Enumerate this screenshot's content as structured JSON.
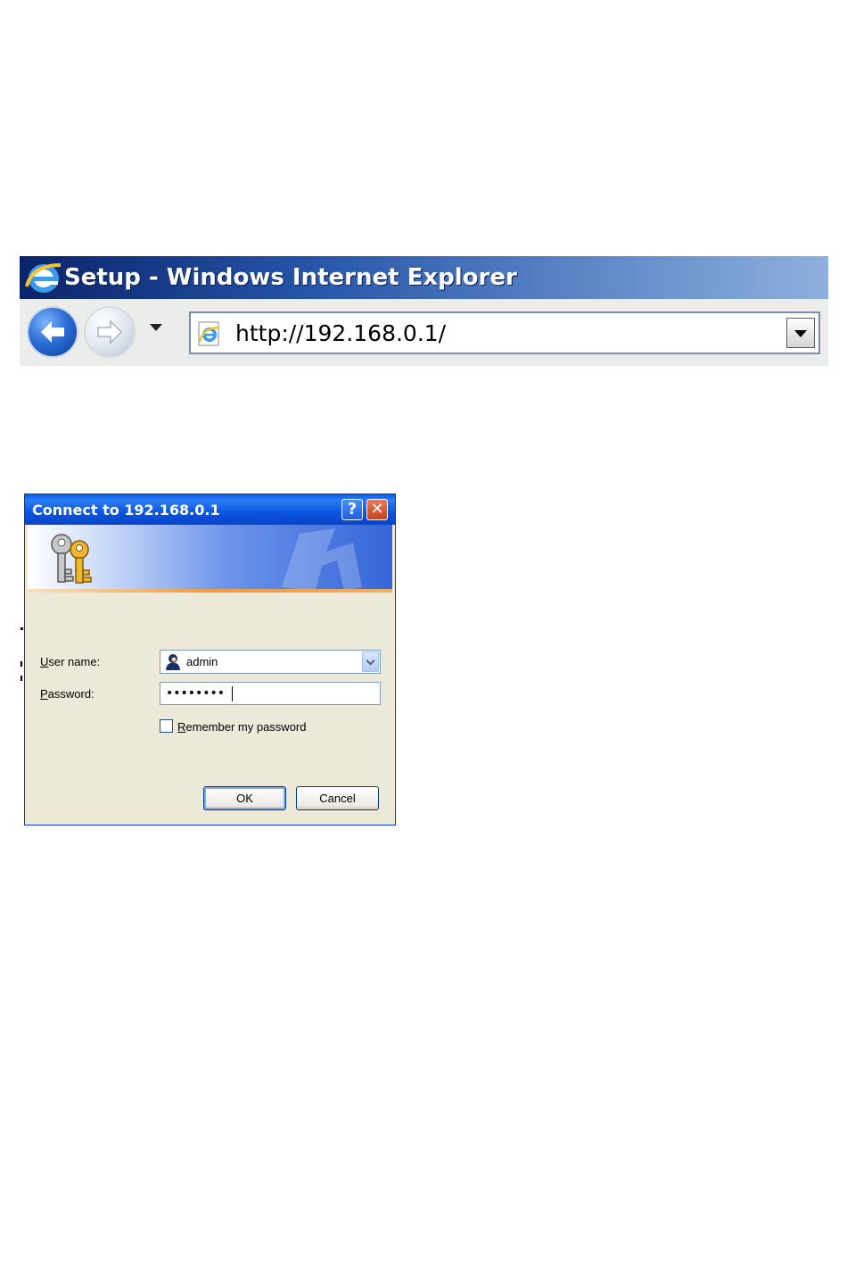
{
  "browser": {
    "title": "Setup - Windows Internet Explorer",
    "address": "http://192.168.0.1/",
    "icons": {
      "app": "ie-logo-icon",
      "back": "back-arrow-icon",
      "forward": "forward-arrow-icon",
      "history": "chevron-down-icon",
      "page": "ie-page-icon",
      "address_dropdown": "dropdown-arrow-icon"
    }
  },
  "dialog": {
    "title": "Connect to 192.168.0.1",
    "help_label": "?",
    "close_label": "✕",
    "user_label_key": "U",
    "user_label_rest": "ser name:",
    "user_value": "admin",
    "password_label_key": "P",
    "password_label_rest": "assword:",
    "password_value": "••••••••",
    "remember_key": "R",
    "remember_rest": "emember my password",
    "remember_checked": false,
    "ok_label": "OK",
    "cancel_label": "Cancel",
    "icons": {
      "banner": "keys-icon",
      "user": "user-icon"
    },
    "colors": {
      "titlebar": "#0a5fe6",
      "face": "#ece9d8",
      "accent_stripe": "#f09a3e"
    }
  }
}
